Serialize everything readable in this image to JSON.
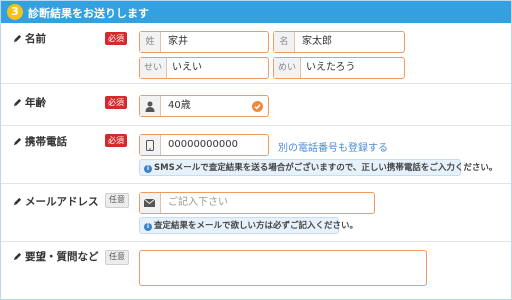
{
  "header": {
    "step": "3",
    "title": "診断結果をお送りします"
  },
  "name_row": {
    "label": "名前",
    "badge": "必須",
    "last_prefix": "姓",
    "last_value": "家井",
    "first_prefix": "名",
    "first_value": "家太郎",
    "last_kana_prefix": "せい",
    "last_kana_value": "いえい",
    "first_kana_prefix": "めい",
    "first_kana_value": "いえたろう"
  },
  "age_row": {
    "label": "年齢",
    "badge": "必須",
    "value": "40歳",
    "icon": "person-icon"
  },
  "phone_row": {
    "label": "携帯電話",
    "badge": "必須",
    "value": "00000000000",
    "icon": "mobile-icon",
    "alt_link": "別の電話番号も登録する",
    "note": "SMSメールで査定結果を送る場合がございますので、正しい携帯電話をご入力ください。"
  },
  "email_row": {
    "label": "メールアドレス",
    "badge": "任意",
    "placeholder": "ご記入下さい",
    "icon": "envelope-icon",
    "note": "査定結果をメールで欲しい方は必ずご記入ください。"
  },
  "request_row": {
    "label": "要望・質問など",
    "badge": "任意",
    "value": ""
  },
  "colors": {
    "header": "#33a0e0",
    "required": "#d12b2b",
    "field_border": "#ef9b60",
    "link": "#4a8ad6"
  }
}
